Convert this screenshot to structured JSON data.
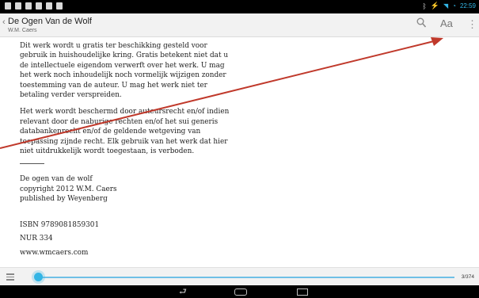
{
  "status_bar": {
    "time": "22:59"
  },
  "action_bar": {
    "title": "De Ogen Van de Wolf",
    "subtitle": "W.M. Caers",
    "font_label": "Aa",
    "overflow_glyph": "⋮",
    "up_glyph": "‹"
  },
  "content": {
    "paragraphs": [
      "Dit werk wordt u gratis ter beschikking gesteld voor gebruik in huishoudelijke kring. Gratis betekent niet dat u de intellectuele eigendom verwerft over het werk. U mag het werk noch inhoudelijk noch vormelijk wijzigen zonder toestemming van de auteur. U mag het werk niet ter betaling verder verspreiden.",
      "Het werk wordt beschermd door auteursrecht en/of indien relevant door de naburige rechten en/of het sui generis databankenrecht en/of de geldende wetgeving van toepassing zijnde recht. Elk gebruik van het werk dat hier niet uitdrukkelijk wordt toegestaan, is verboden."
    ],
    "book_title": "De ogen van de wolf",
    "copyright": "copyright 2012 W.M. Caers",
    "publisher": "published by Weyenberg",
    "isbn": "ISBN 9789081859301",
    "nur": "NUR 334",
    "website": "www.wmcaers.com"
  },
  "reader_bar": {
    "page_counter": "3/374",
    "progress_fraction": 0.008
  },
  "nav_bar": {
    "back_glyph": "⮐"
  },
  "colors": {
    "accent": "#33b5e5",
    "annotation": "#c0392b"
  }
}
